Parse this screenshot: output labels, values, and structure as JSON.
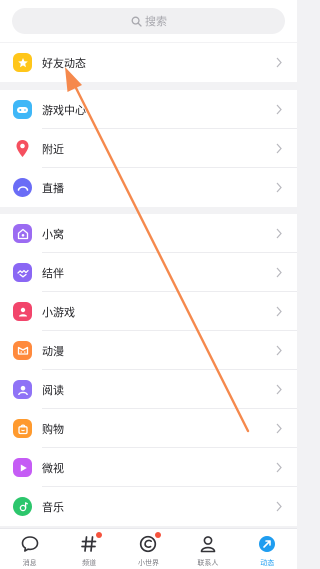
{
  "search": {
    "placeholder": "搜索"
  },
  "groups": [
    {
      "items": [
        {
          "label": "好友动态",
          "icon": "star-icon",
          "color": "#ffc61a"
        }
      ]
    },
    {
      "items": [
        {
          "label": "游戏中心",
          "icon": "gamepad-icon",
          "color": "#3fb7f7"
        },
        {
          "label": "附近",
          "icon": "location-pin-icon",
          "color": "#f5505f"
        },
        {
          "label": "直播",
          "icon": "live-icon",
          "color": "#6a6cf6"
        }
      ]
    },
    {
      "items": [
        {
          "label": "小窝",
          "icon": "home-icon",
          "color": "#9b6bf2"
        },
        {
          "label": "结伴",
          "icon": "partner-icon",
          "color": "#8a67f4"
        },
        {
          "label": "小游戏",
          "icon": "mini-game-icon",
          "color": "#f2456b"
        },
        {
          "label": "动漫",
          "icon": "anime-icon",
          "color": "#ff8a3d"
        },
        {
          "label": "阅读",
          "icon": "reading-icon",
          "color": "#8f73f6"
        },
        {
          "label": "购物",
          "icon": "shopping-icon",
          "color": "#ff9a2e"
        },
        {
          "label": "微视",
          "icon": "video-icon",
          "color": "#c55cf5"
        },
        {
          "label": "音乐",
          "icon": "music-icon",
          "color": "#2cc66c"
        }
      ]
    }
  ],
  "tabbar": [
    {
      "label": "消息",
      "icon": "chat-bubble-icon",
      "active": false,
      "dot": false
    },
    {
      "label": "频道",
      "icon": "hashtag-icon",
      "active": false,
      "dot": true
    },
    {
      "label": "小世界",
      "icon": "world-icon",
      "active": false,
      "dot": true
    },
    {
      "label": "联系人",
      "icon": "contacts-icon",
      "active": false,
      "dot": false
    },
    {
      "label": "动态",
      "icon": "moments-icon",
      "active": true,
      "dot": false
    }
  ],
  "colors": {
    "accent": "#1f9df0",
    "arrow": "#f5894d",
    "badge": "#f5533d"
  }
}
